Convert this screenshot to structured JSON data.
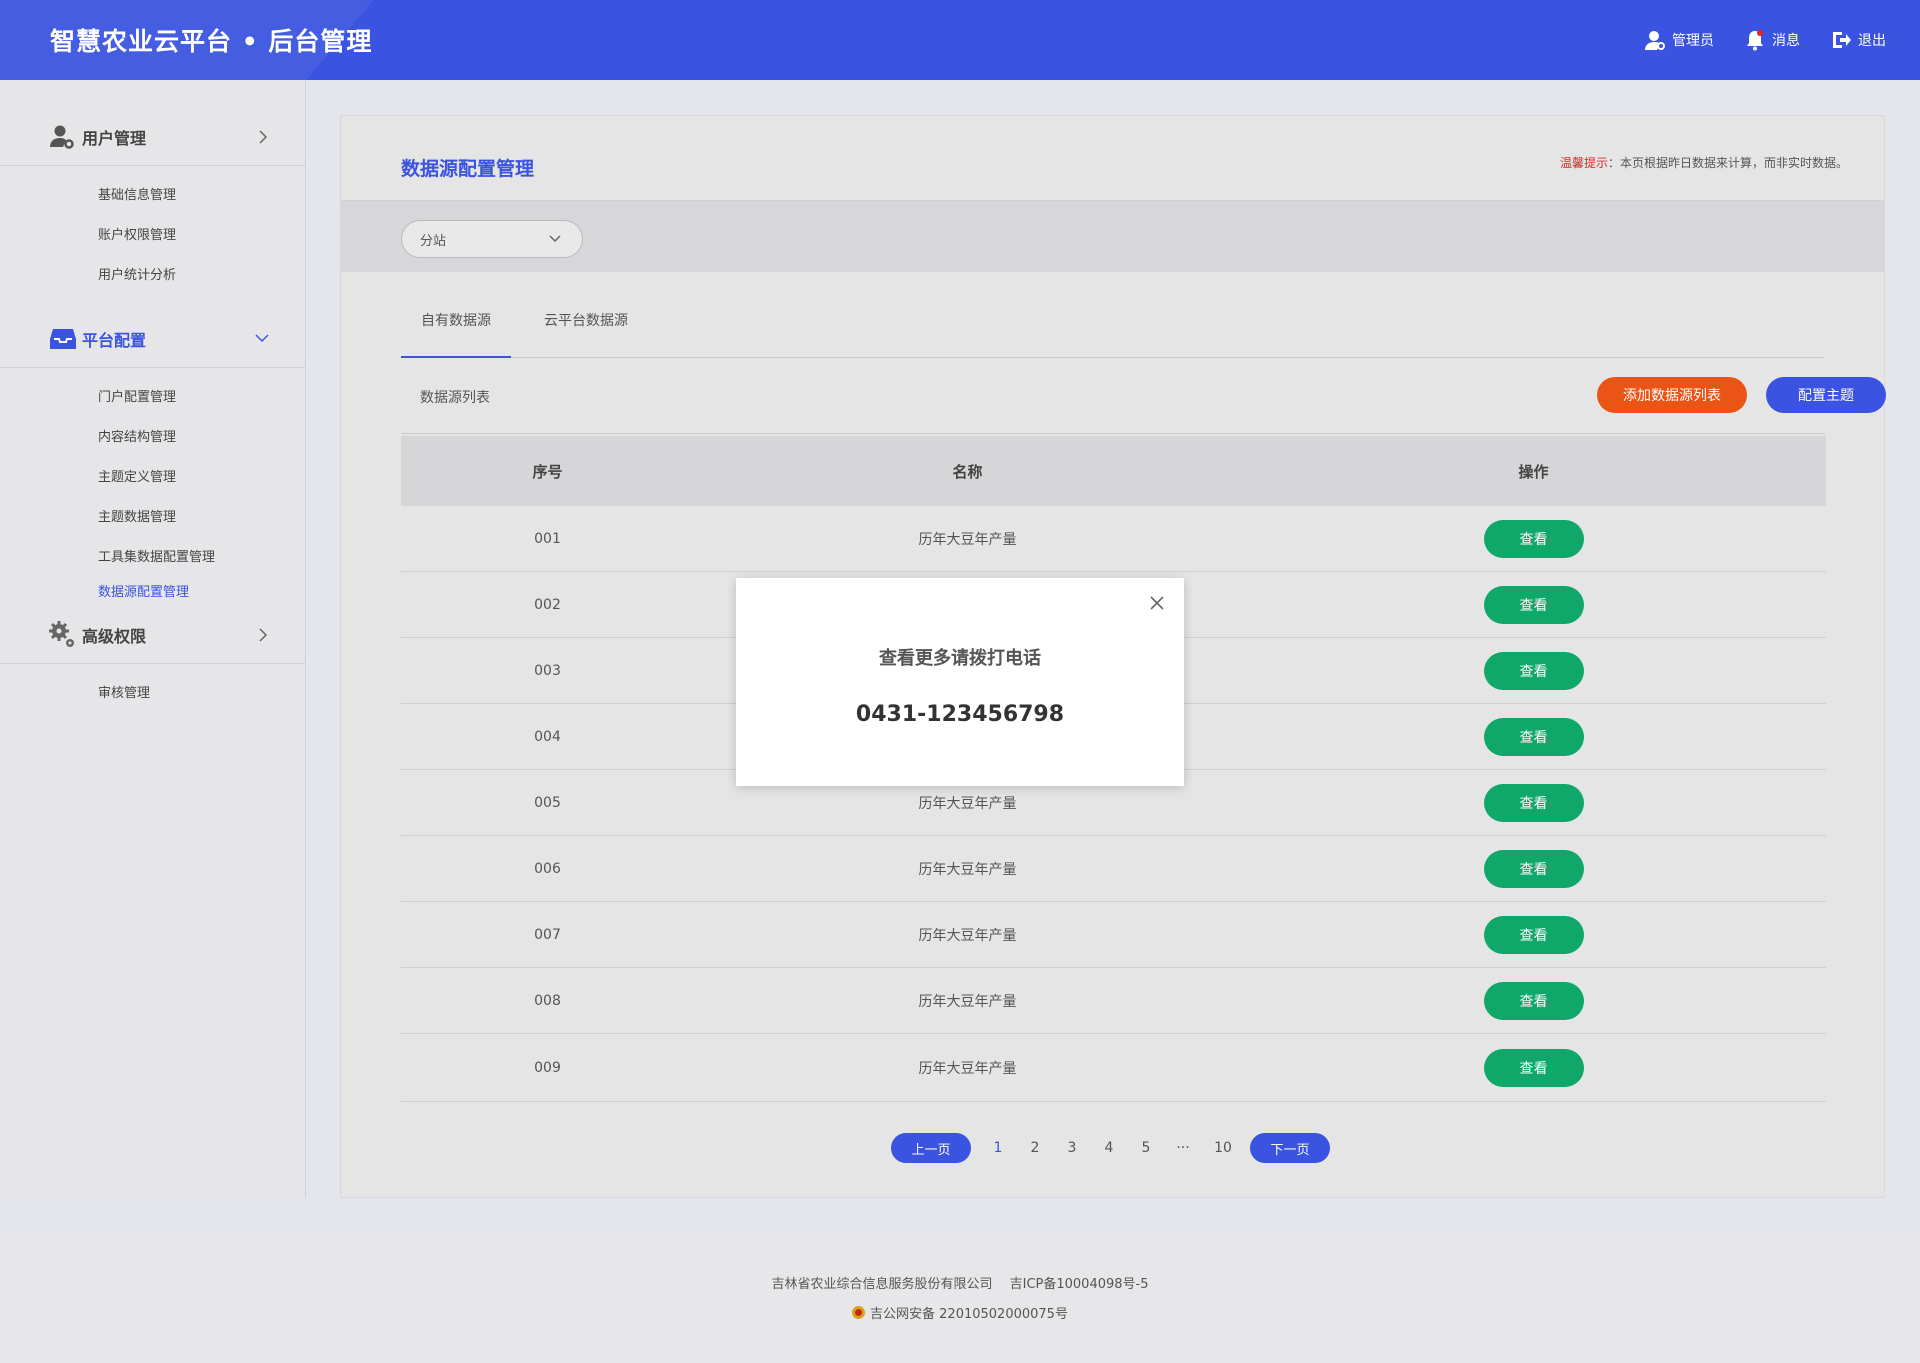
{
  "header": {
    "title": "智慧农业云平台 • 后台管理",
    "admin_label": "管理员",
    "message_label": "消息",
    "logout_label": "退出"
  },
  "sidebar": {
    "groups": [
      {
        "label": "用户管理",
        "icon": "user-gear-icon",
        "items": [
          "基础信息管理",
          "账户权限管理",
          "用户统计分析"
        ]
      },
      {
        "label": "平台配置",
        "icon": "inbox-icon",
        "items": [
          "门户配置管理",
          "内容结构管理",
          "主题定义管理",
          "主题数据管理",
          "工具集数据配置管理",
          "数据源配置管理"
        ]
      },
      {
        "label": "高级权限",
        "icon": "gears-icon",
        "items": [
          "审核管理"
        ]
      }
    ]
  },
  "panel": {
    "title": "数据源配置管理",
    "tip_label": "温馨提示",
    "tip_text": "：本页根据昨日数据来计算，而非实时数据。",
    "select_value": "分站",
    "tabs": [
      "自有数据源",
      "云平台数据源"
    ],
    "list_title": "数据源列表",
    "add_button": "添加数据源列表",
    "theme_button": "配置主题"
  },
  "table": {
    "headers": [
      "序号",
      "名称",
      "操作"
    ],
    "view_label": "查看",
    "rows": [
      {
        "no": "001",
        "name": "历年大豆年产量"
      },
      {
        "no": "002",
        "name": ""
      },
      {
        "no": "003",
        "name": ""
      },
      {
        "no": "004",
        "name": ""
      },
      {
        "no": "005",
        "name": "历年大豆年产量"
      },
      {
        "no": "006",
        "name": "历年大豆年产量"
      },
      {
        "no": "007",
        "name": "历年大豆年产量"
      },
      {
        "no": "008",
        "name": "历年大豆年产量"
      },
      {
        "no": "009",
        "name": "历年大豆年产量"
      }
    ]
  },
  "pager": {
    "prev": "上一页",
    "pages": [
      "1",
      "2",
      "3",
      "4",
      "5"
    ],
    "ellipsis": "···",
    "last": "10",
    "next": "下一页"
  },
  "footer": {
    "line1": "吉林省农业综合信息服务股份有限公司　 吉ICP备10004098号-5",
    "line2": "吉公网安备 22010502000075号"
  },
  "modal": {
    "message": "查看更多请拨打电话",
    "phone": "0431-123456798"
  },
  "colors": {
    "primary": "#3a53e0",
    "accent_orange": "#ea5414",
    "accent_green": "#0fa86a",
    "tip_red": "#e52525"
  }
}
